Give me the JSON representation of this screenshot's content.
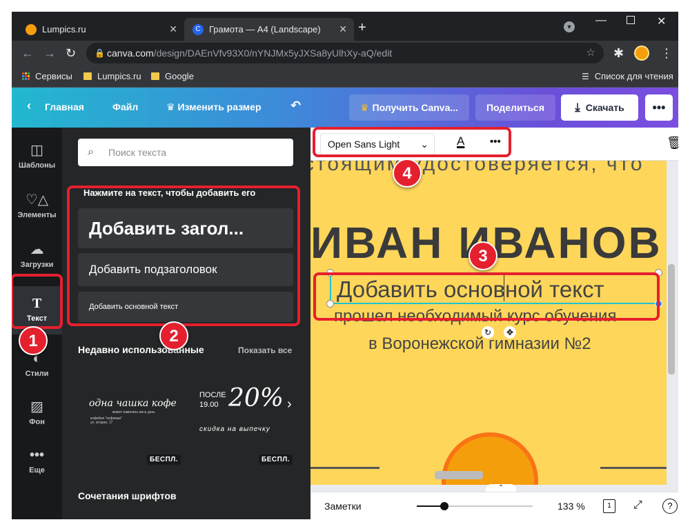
{
  "browser": {
    "tabs": [
      {
        "title": "Lumpics.ru",
        "favicon_color": "#f59e0b"
      },
      {
        "title": "Грамота — A4 (Landscape)",
        "favicon_color": "#2563eb"
      }
    ],
    "url_host": "canva.com",
    "url_path": "/design/DAEnVfv93X0/nYNJMx5yJXSa8yUlhXy-aQ/edit",
    "bookmarks": [
      "Сервисы",
      "Lumpics.ru",
      "Google"
    ],
    "reading_list": "Список для чтения"
  },
  "header": {
    "home": "Главная",
    "file": "Файл",
    "resize": "Изменить размер",
    "get_canva": "Получить Canva...",
    "share": "Поделиться",
    "download": "Скачать"
  },
  "rail": {
    "items": [
      {
        "label": "Шаблоны",
        "icon": "templates-icon"
      },
      {
        "label": "Элементы",
        "icon": "elements-icon"
      },
      {
        "label": "Загрузки",
        "icon": "upload-icon"
      },
      {
        "label": "Текст",
        "icon": "text-icon"
      },
      {
        "label": "Стили",
        "icon": "styles-icon"
      },
      {
        "label": "Фон",
        "icon": "background-icon"
      },
      {
        "label": "Еще",
        "icon": "more-icon"
      }
    ]
  },
  "panel": {
    "search_placeholder": "Поиск текста",
    "hint": "Нажмите на текст, чтобы добавить его",
    "add_heading": "Добавить загол...",
    "add_subheading": "Добавить подзаголовок",
    "add_body": "Добавить основной текст",
    "recent_title": "Недавно использованные",
    "show_all": "Показать все",
    "preset1_line1": "одна чашка кофе",
    "preset1_line2": "может изменить весь день",
    "preset1_line3": "кофейня \"кофеман\"",
    "preset1_line4": "ул. вторая, 17",
    "preset2_line1": "ПОСЛЕ",
    "preset2_line2": "19.00",
    "preset2_big": "20%",
    "preset2_line3": "скидка на выпечку",
    "free_badge": "БЕСПЛ.",
    "font_combos": "Сочетания шрифтов"
  },
  "editor": {
    "font_name": "Open Sans Light",
    "doc_line_top": "стоящим удостоверяется, что",
    "doc_name": "ИВАН ИВАНОВ",
    "doc_body_selected": "Добавить основной текст",
    "doc_line2": "прошел необходимый курс обучения",
    "doc_line3": "в Воронежской гимназии №2",
    "notes": "Заметки",
    "zoom": "133 %",
    "page_count": "1",
    "zoom_fraction": 0.24
  },
  "annotations": {
    "step1": "1",
    "step2": "2",
    "step3": "3",
    "step4": "4"
  },
  "colors": {
    "annotation_red": "#e5202e",
    "doc_yellow": "#fdd65a",
    "selection_teal": "#20c4cb"
  }
}
